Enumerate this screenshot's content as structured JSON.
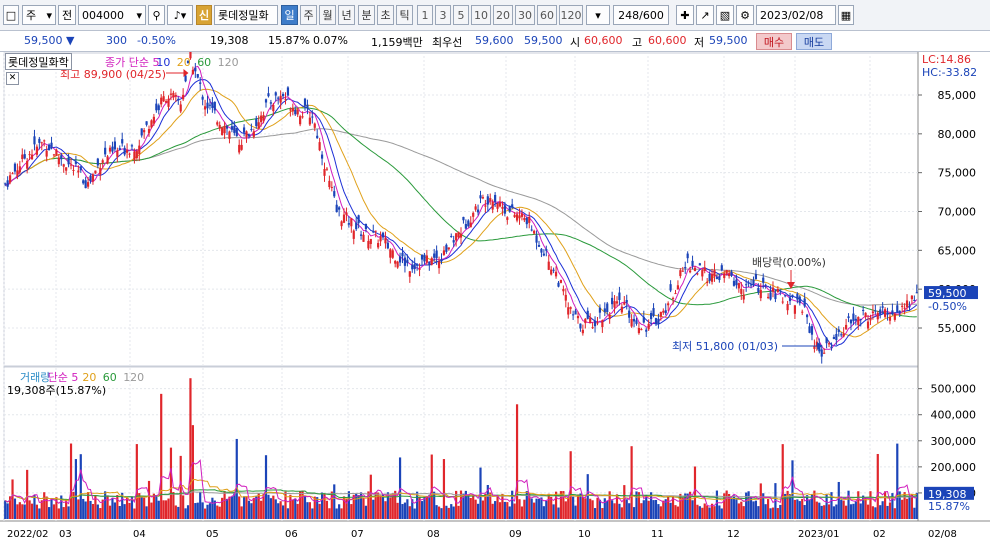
{
  "toolbar": {
    "market": "주",
    "prev": "전",
    "code": "004000",
    "badge": "신",
    "name": "롯데정밀화",
    "period_tabs": [
      "일",
      "주",
      "월",
      "년",
      "분",
      "초",
      "틱"
    ],
    "period_active": "일",
    "numbers": [
      "1",
      "3",
      "5",
      "10",
      "20",
      "30",
      "60",
      "120"
    ],
    "count": "248/600",
    "date": "2023/02/08"
  },
  "info": {
    "price": "59,500",
    "change": "300",
    "change_rate": "-0.50%",
    "volume": "19,308",
    "volume_rate": "15.87%",
    "turnover": "0.07%",
    "amount_label": "1,159백만",
    "best_label": "최우선",
    "best_sell": "59,600",
    "best_buy": "59,500",
    "open_label": "시",
    "open": "60,600",
    "high_label": "고",
    "high": "60,600",
    "low_label": "저",
    "low": "59,500",
    "buy_label": "매수",
    "sell_label": "매도"
  },
  "colors": {
    "up": "#e0262b",
    "down": "#1b44b8",
    "ma5": "#1c2fd6",
    "ma10": "#d11fbe",
    "ma20": "#e0a11b",
    "ma60": "#2a9a3b",
    "ma120": "#9a9a9a",
    "grid": "#e4e7ec"
  },
  "chart_data": {
    "type": "candlestick",
    "title": "롯데정밀화학",
    "price_legend": [
      {
        "text": "종가 단순 5",
        "color": "#d11fbe"
      },
      {
        "text": "10",
        "color": "#1c2fd6"
      },
      {
        "text": "20",
        "color": "#e0a11b"
      },
      {
        "text": "60",
        "color": "#2a9a3b"
      },
      {
        "text": "120",
        "color": "#9a9a9a"
      }
    ],
    "price_yticks": [
      "85,000",
      "80,000",
      "75,000",
      "70,000",
      "65,000",
      "60,000",
      "55,000"
    ],
    "price_ylim": [
      50000,
      90000
    ],
    "lc_label": "LC:14.86",
    "hc_label": "HC:-33.82",
    "last_price": "59,500",
    "last_change": "-0.50%",
    "high_annotation": "최고 89,900 (04/25)",
    "low_annotation": "최저 51,800 (01/03)",
    "dividend_annotation": "배당락(0.00%)",
    "volume_legend": [
      {
        "text": "거래량",
        "color": "#2a8bc6"
      },
      {
        "text": "단순 5",
        "color": "#d11fbe"
      },
      {
        "text": "20",
        "color": "#e0a11b"
      },
      {
        "text": "60",
        "color": "#2a9a3b"
      },
      {
        "text": "120",
        "color": "#9a9a9a"
      }
    ],
    "volume_value_label": "19,308주(15.87%)",
    "volume_yticks": [
      "500,000",
      "400,000",
      "300,000",
      "200,000",
      "100,000"
    ],
    "volume_ylim": [
      0,
      560000
    ],
    "last_volume": "19,308",
    "last_volume_rate": "15.87%",
    "x_labels": [
      "2022/02",
      "03",
      "04",
      "05",
      "06",
      "07",
      "08",
      "09",
      "10",
      "11",
      "12",
      "2023/01",
      "02",
      "02/08"
    ],
    "price_path": [
      [
        0,
        73500
      ],
      [
        8,
        77000
      ],
      [
        16,
        79000
      ],
      [
        24,
        76500
      ],
      [
        30,
        75000
      ],
      [
        34,
        73500
      ],
      [
        40,
        77000
      ],
      [
        48,
        78000
      ],
      [
        54,
        78500
      ],
      [
        60,
        82000
      ],
      [
        66,
        85000
      ],
      [
        72,
        84000
      ],
      [
        76,
        89900
      ],
      [
        82,
        84000
      ],
      [
        90,
        81000
      ],
      [
        96,
        79000
      ],
      [
        101,
        80500
      ],
      [
        108,
        84000
      ],
      [
        114,
        85000
      ],
      [
        120,
        83000
      ],
      [
        126,
        82500
      ],
      [
        130,
        77500
      ],
      [
        136,
        70000
      ],
      [
        142,
        68500
      ],
      [
        148,
        67000
      ],
      [
        154,
        66500
      ],
      [
        160,
        64500
      ],
      [
        166,
        63000
      ],
      [
        172,
        63500
      ],
      [
        178,
        64000
      ],
      [
        182,
        65500
      ],
      [
        190,
        69000
      ],
      [
        196,
        71500
      ],
      [
        200,
        72000
      ],
      [
        206,
        70000
      ],
      [
        214,
        69000
      ],
      [
        220,
        65500
      ],
      [
        226,
        62000
      ],
      [
        232,
        57000
      ],
      [
        236,
        55500
      ],
      [
        242,
        56000
      ],
      [
        248,
        57500
      ],
      [
        254,
        58000
      ],
      [
        258,
        56000
      ],
      [
        264,
        55200
      ],
      [
        270,
        57000
      ],
      [
        276,
        61000
      ],
      [
        280,
        63500
      ],
      [
        286,
        62000
      ],
      [
        292,
        61500
      ],
      [
        296,
        62000
      ],
      [
        302,
        60000
      ],
      [
        308,
        60500
      ],
      [
        314,
        59500
      ],
      [
        320,
        59000
      ],
      [
        324,
        58500
      ],
      [
        328,
        57500
      ],
      [
        332,
        53000
      ],
      [
        336,
        51800
      ],
      [
        340,
        53500
      ],
      [
        346,
        55500
      ],
      [
        352,
        56500
      ],
      [
        358,
        56800
      ],
      [
        364,
        57000
      ],
      [
        368,
        57500
      ],
      [
        372,
        58500
      ],
      [
        374,
        59500
      ]
    ]
  }
}
